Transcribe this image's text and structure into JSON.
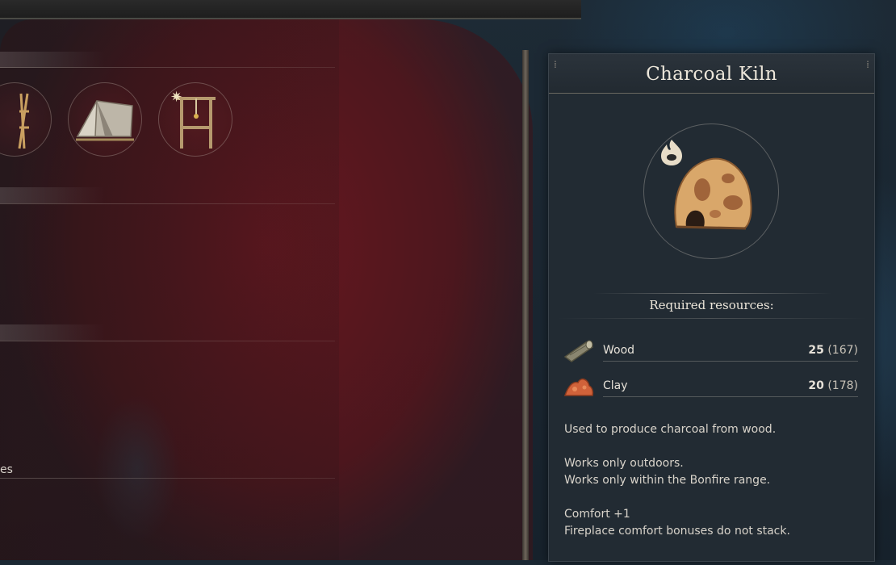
{
  "left_panel": {
    "partial_label": "es",
    "build_icons": [
      "drying-rack-icon",
      "tent-icon",
      "gallows-icon"
    ]
  },
  "detail_panel": {
    "title": "Charcoal Kiln",
    "item_icon": "charcoal-kiln-icon",
    "badge_icon": "fire-icon",
    "required_label": "Required resources:",
    "resources": [
      {
        "name": "Wood",
        "icon": "wood-log-icon",
        "required": "25",
        "owned": "(167)"
      },
      {
        "name": "Clay",
        "icon": "clay-pile-icon",
        "required": "20",
        "owned": "(178)"
      }
    ],
    "description": [
      "Used to produce charcoal from wood.",
      "Works only outdoors.",
      "Works only within the Bonfire range.",
      "Comfort +1",
      "Fireplace comfort bonuses do not stack."
    ]
  }
}
